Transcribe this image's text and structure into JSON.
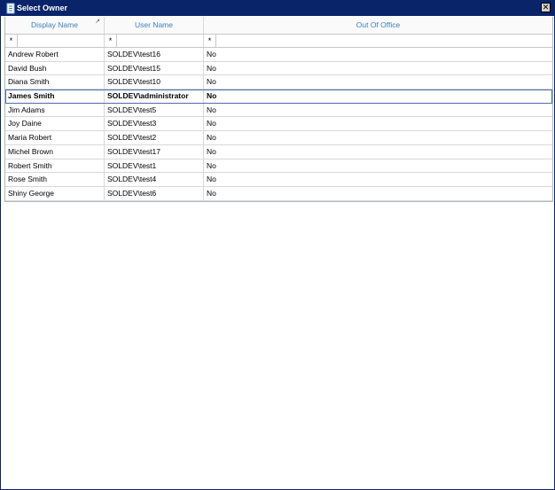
{
  "window": {
    "title": "Select Owner",
    "close_glyph": "✕",
    "accent": "#0a246a"
  },
  "grid": {
    "columns": [
      "Display Name",
      "User Name",
      "Out Of Office"
    ],
    "sort_indicator": "↗",
    "filter_symbol": "*",
    "rows": [
      [
        "Andrew Robert",
        "SOLDEV\\test16",
        "No"
      ],
      [
        "David Bush",
        "SOLDEV\\test15",
        "No"
      ],
      [
        "Diana Smith",
        "SOLDEV\\test10",
        "No"
      ],
      [
        "James Smith",
        "SOLDEV\\administrator",
        "No"
      ],
      [
        "Jim Adams",
        "SOLDEV\\test5",
        "No"
      ],
      [
        "Joy Daine",
        "SOLDEV\\test3",
        "No"
      ],
      [
        "Maria Robert",
        "SOLDEV\\test2",
        "No"
      ],
      [
        "Michel Brown",
        "SOLDEV\\test17",
        "No"
      ],
      [
        "Robert Smith",
        "SOLDEV\\test1",
        "No"
      ],
      [
        "Rose Smith",
        "SOLDEV\\test4",
        "No"
      ],
      [
        "Shiny George",
        "SOLDEV\\test6",
        "No"
      ]
    ],
    "selected_row": "James Smith"
  }
}
